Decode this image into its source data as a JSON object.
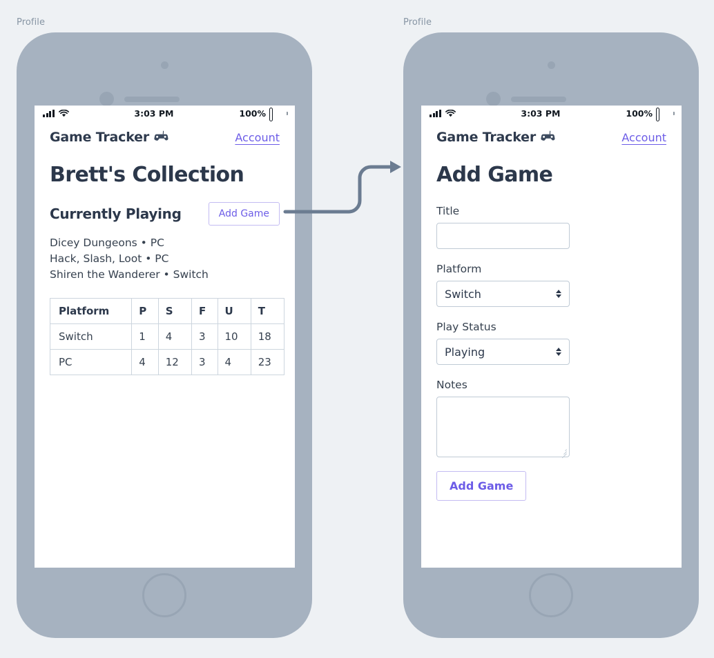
{
  "background_color": "#eef1f4",
  "accent_color": "#6c5ce7",
  "phone_body_color": "#a6b2c0",
  "status_bar": {
    "signal_icon": "cellular-signal-icon",
    "wifi_icon": "wifi-icon",
    "time": "3:03 PM",
    "battery_percent": "100%",
    "battery_icon": "battery-full-icon"
  },
  "app_header": {
    "title": "Game Tracker",
    "title_icon": "gamepad-icon",
    "account_label": "Account"
  },
  "screens": [
    {
      "label": "Profile",
      "page_title": "Brett's Collection",
      "section_title": "Currently Playing",
      "add_game_label": "Add Game",
      "playing": [
        "Dicey Dungeons • PC",
        "Hack, Slash, Loot • PC",
        "Shiren the Wanderer • Switch"
      ],
      "table": {
        "headers": [
          "Platform",
          "P",
          "S",
          "F",
          "U",
          "T"
        ],
        "rows": [
          [
            "Switch",
            "1",
            "4",
            "3",
            "10",
            "18"
          ],
          [
            "PC",
            "4",
            "12",
            "3",
            "4",
            "23"
          ]
        ]
      }
    },
    {
      "label": "Profile",
      "page_title": "Add Game",
      "fields": [
        {
          "label": "Title",
          "type": "text",
          "value": ""
        },
        {
          "label": "Platform",
          "type": "select",
          "value": "Switch"
        },
        {
          "label": "Play Status",
          "type": "select",
          "value": "Playing"
        },
        {
          "label": "Notes",
          "type": "textarea",
          "value": ""
        }
      ],
      "submit_label": "Add Game"
    }
  ]
}
